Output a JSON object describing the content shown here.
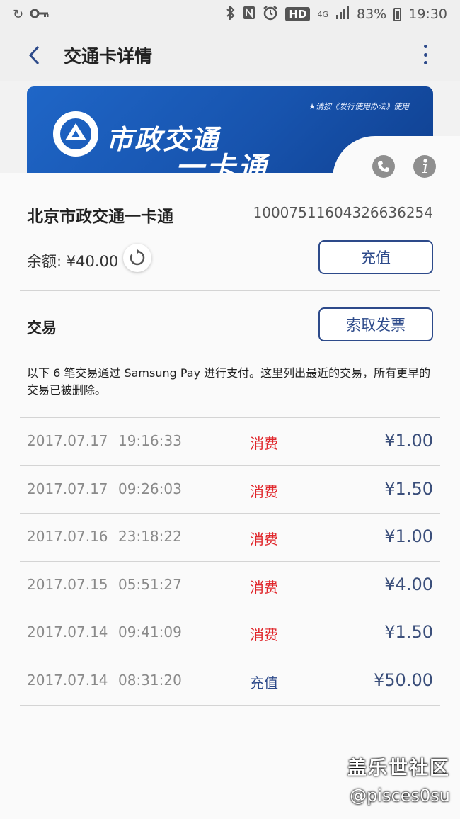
{
  "status_bar": {
    "battery": "83%",
    "time": "19:30",
    "hd": "HD",
    "network": "4G"
  },
  "header": {
    "title": "交通卡详情"
  },
  "card": {
    "note": "★请按《发行使用办法》使用",
    "brand_line1": "市政交通",
    "brand_line2": "一卡通",
    "name": "北京市政交通一卡通",
    "number": "10007511604326636254"
  },
  "balance": {
    "label": "余额: ¥40.00"
  },
  "buttons": {
    "recharge": "充值",
    "invoice": "索取发票"
  },
  "transactions": {
    "heading": "交易",
    "note": "以下 6 笔交易通过 Samsung Pay 进行支付。这里列出最近的交易，所有更早的交易已被删除。",
    "rows": [
      {
        "date": "2017.07.17",
        "time": "19:16:33",
        "type": "消费",
        "amount": "¥1.00",
        "type_color": "#e0262b"
      },
      {
        "date": "2017.07.17",
        "time": "09:26:03",
        "type": "消费",
        "amount": "¥1.50",
        "type_color": "#e0262b"
      },
      {
        "date": "2017.07.16",
        "time": "23:18:22",
        "type": "消费",
        "amount": "¥1.00",
        "type_color": "#e0262b"
      },
      {
        "date": "2017.07.15",
        "time": "05:51:27",
        "type": "消费",
        "amount": "¥4.00",
        "type_color": "#e0262b"
      },
      {
        "date": "2017.07.14",
        "time": "09:41:09",
        "type": "消费",
        "amount": "¥1.50",
        "type_color": "#e0262b"
      },
      {
        "date": "2017.07.14",
        "time": "08:31:20",
        "type": "充值",
        "amount": "¥50.00",
        "type_color": "#2d4a8a"
      }
    ]
  },
  "watermark": {
    "line1": "盖乐世社区",
    "line2": "@pisces0su"
  },
  "colors": {
    "accent": "#2d4a8a",
    "spend": "#e0262b",
    "card_blue": "#1f66c7"
  },
  "icons": {
    "back": "chevron-left-icon",
    "more": "more-vertical-icon",
    "phone": "phone-icon",
    "info": "info-icon",
    "refresh": "refresh-icon"
  }
}
